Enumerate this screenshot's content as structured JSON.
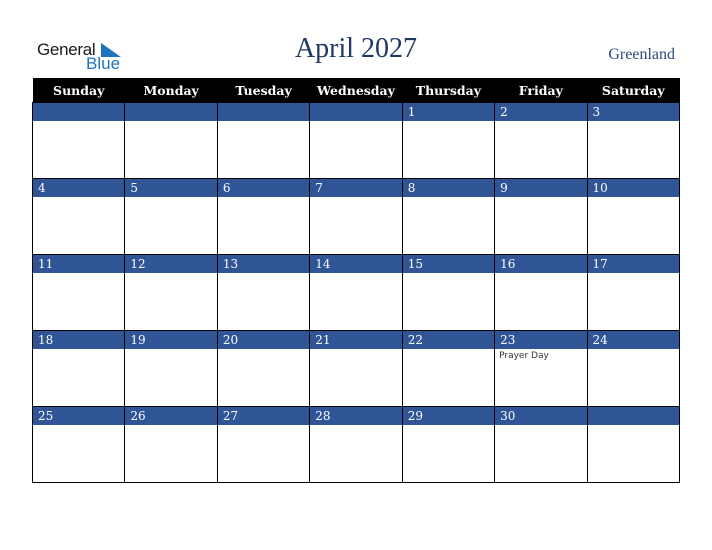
{
  "logo": {
    "line1": "General",
    "line2": "Blue"
  },
  "title": "April 2027",
  "country": "Greenland",
  "colors": {
    "header_bg": "#000000",
    "day_bar": "#2f5597",
    "title": "#1f3864",
    "logo_blue": "#1d73c0"
  },
  "weekdays": [
    "Sunday",
    "Monday",
    "Tuesday",
    "Wednesday",
    "Thursday",
    "Friday",
    "Saturday"
  ],
  "weeks": [
    [
      {
        "day": ""
      },
      {
        "day": ""
      },
      {
        "day": ""
      },
      {
        "day": ""
      },
      {
        "day": "1"
      },
      {
        "day": "2"
      },
      {
        "day": "3"
      }
    ],
    [
      {
        "day": "4"
      },
      {
        "day": "5"
      },
      {
        "day": "6"
      },
      {
        "day": "7"
      },
      {
        "day": "8"
      },
      {
        "day": "9"
      },
      {
        "day": "10"
      }
    ],
    [
      {
        "day": "11"
      },
      {
        "day": "12"
      },
      {
        "day": "13"
      },
      {
        "day": "14"
      },
      {
        "day": "15"
      },
      {
        "day": "16"
      },
      {
        "day": "17"
      }
    ],
    [
      {
        "day": "18"
      },
      {
        "day": "19"
      },
      {
        "day": "20"
      },
      {
        "day": "21"
      },
      {
        "day": "22"
      },
      {
        "day": "23",
        "event": "Prayer Day"
      },
      {
        "day": "24"
      }
    ],
    [
      {
        "day": "25"
      },
      {
        "day": "26"
      },
      {
        "day": "27"
      },
      {
        "day": "28"
      },
      {
        "day": "29"
      },
      {
        "day": "30"
      },
      {
        "day": ""
      }
    ]
  ]
}
